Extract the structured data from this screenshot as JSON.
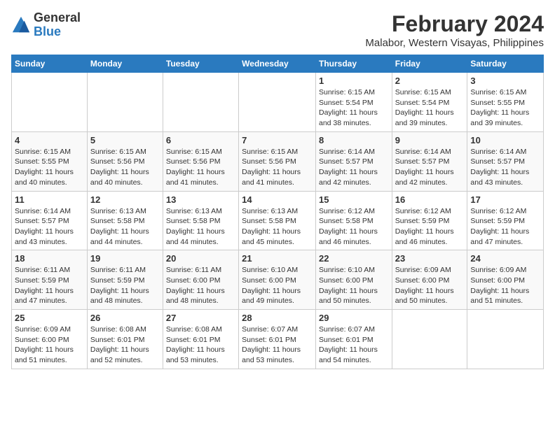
{
  "header": {
    "logo_general": "General",
    "logo_blue": "Blue",
    "month_year": "February 2024",
    "location": "Malabor, Western Visayas, Philippines"
  },
  "days_of_week": [
    "Sunday",
    "Monday",
    "Tuesday",
    "Wednesday",
    "Thursday",
    "Friday",
    "Saturday"
  ],
  "weeks": [
    [
      {
        "day": "",
        "info": ""
      },
      {
        "day": "",
        "info": ""
      },
      {
        "day": "",
        "info": ""
      },
      {
        "day": "",
        "info": ""
      },
      {
        "day": "1",
        "info": "Sunrise: 6:15 AM\nSunset: 5:54 PM\nDaylight: 11 hours\nand 38 minutes."
      },
      {
        "day": "2",
        "info": "Sunrise: 6:15 AM\nSunset: 5:54 PM\nDaylight: 11 hours\nand 39 minutes."
      },
      {
        "day": "3",
        "info": "Sunrise: 6:15 AM\nSunset: 5:55 PM\nDaylight: 11 hours\nand 39 minutes."
      }
    ],
    [
      {
        "day": "4",
        "info": "Sunrise: 6:15 AM\nSunset: 5:55 PM\nDaylight: 11 hours\nand 40 minutes."
      },
      {
        "day": "5",
        "info": "Sunrise: 6:15 AM\nSunset: 5:56 PM\nDaylight: 11 hours\nand 40 minutes."
      },
      {
        "day": "6",
        "info": "Sunrise: 6:15 AM\nSunset: 5:56 PM\nDaylight: 11 hours\nand 41 minutes."
      },
      {
        "day": "7",
        "info": "Sunrise: 6:15 AM\nSunset: 5:56 PM\nDaylight: 11 hours\nand 41 minutes."
      },
      {
        "day": "8",
        "info": "Sunrise: 6:14 AM\nSunset: 5:57 PM\nDaylight: 11 hours\nand 42 minutes."
      },
      {
        "day": "9",
        "info": "Sunrise: 6:14 AM\nSunset: 5:57 PM\nDaylight: 11 hours\nand 42 minutes."
      },
      {
        "day": "10",
        "info": "Sunrise: 6:14 AM\nSunset: 5:57 PM\nDaylight: 11 hours\nand 43 minutes."
      }
    ],
    [
      {
        "day": "11",
        "info": "Sunrise: 6:14 AM\nSunset: 5:57 PM\nDaylight: 11 hours\nand 43 minutes."
      },
      {
        "day": "12",
        "info": "Sunrise: 6:13 AM\nSunset: 5:58 PM\nDaylight: 11 hours\nand 44 minutes."
      },
      {
        "day": "13",
        "info": "Sunrise: 6:13 AM\nSunset: 5:58 PM\nDaylight: 11 hours\nand 44 minutes."
      },
      {
        "day": "14",
        "info": "Sunrise: 6:13 AM\nSunset: 5:58 PM\nDaylight: 11 hours\nand 45 minutes."
      },
      {
        "day": "15",
        "info": "Sunrise: 6:12 AM\nSunset: 5:58 PM\nDaylight: 11 hours\nand 46 minutes."
      },
      {
        "day": "16",
        "info": "Sunrise: 6:12 AM\nSunset: 5:59 PM\nDaylight: 11 hours\nand 46 minutes."
      },
      {
        "day": "17",
        "info": "Sunrise: 6:12 AM\nSunset: 5:59 PM\nDaylight: 11 hours\nand 47 minutes."
      }
    ],
    [
      {
        "day": "18",
        "info": "Sunrise: 6:11 AM\nSunset: 5:59 PM\nDaylight: 11 hours\nand 47 minutes."
      },
      {
        "day": "19",
        "info": "Sunrise: 6:11 AM\nSunset: 5:59 PM\nDaylight: 11 hours\nand 48 minutes."
      },
      {
        "day": "20",
        "info": "Sunrise: 6:11 AM\nSunset: 6:00 PM\nDaylight: 11 hours\nand 48 minutes."
      },
      {
        "day": "21",
        "info": "Sunrise: 6:10 AM\nSunset: 6:00 PM\nDaylight: 11 hours\nand 49 minutes."
      },
      {
        "day": "22",
        "info": "Sunrise: 6:10 AM\nSunset: 6:00 PM\nDaylight: 11 hours\nand 50 minutes."
      },
      {
        "day": "23",
        "info": "Sunrise: 6:09 AM\nSunset: 6:00 PM\nDaylight: 11 hours\nand 50 minutes."
      },
      {
        "day": "24",
        "info": "Sunrise: 6:09 AM\nSunset: 6:00 PM\nDaylight: 11 hours\nand 51 minutes."
      }
    ],
    [
      {
        "day": "25",
        "info": "Sunrise: 6:09 AM\nSunset: 6:00 PM\nDaylight: 11 hours\nand 51 minutes."
      },
      {
        "day": "26",
        "info": "Sunrise: 6:08 AM\nSunset: 6:01 PM\nDaylight: 11 hours\nand 52 minutes."
      },
      {
        "day": "27",
        "info": "Sunrise: 6:08 AM\nSunset: 6:01 PM\nDaylight: 11 hours\nand 53 minutes."
      },
      {
        "day": "28",
        "info": "Sunrise: 6:07 AM\nSunset: 6:01 PM\nDaylight: 11 hours\nand 53 minutes."
      },
      {
        "day": "29",
        "info": "Sunrise: 6:07 AM\nSunset: 6:01 PM\nDaylight: 11 hours\nand 54 minutes."
      },
      {
        "day": "",
        "info": ""
      },
      {
        "day": "",
        "info": ""
      }
    ]
  ]
}
